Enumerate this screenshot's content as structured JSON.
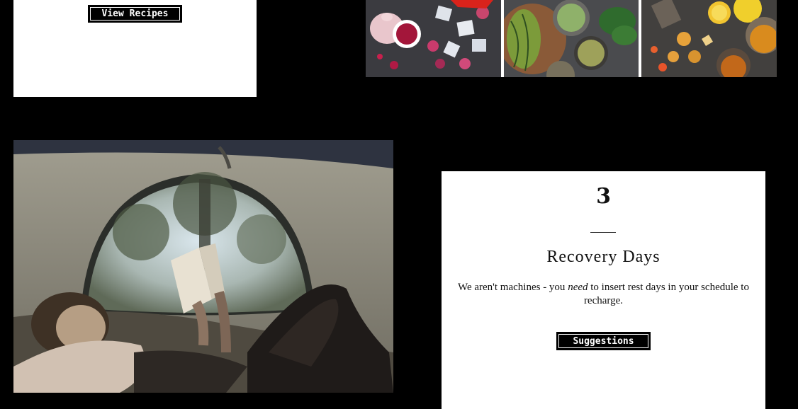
{
  "recipes_card": {
    "button_label": "View Recipes"
  },
  "food_gallery": {
    "panels": [
      {
        "name": "berries-and-ice-photo"
      },
      {
        "name": "melon-and-herbs-photo"
      },
      {
        "name": "citrus-and-spices-photo"
      }
    ]
  },
  "tent_photo": {
    "name": "woman-reading-in-tent-photo"
  },
  "recovery_card": {
    "number": "3",
    "title": "Recovery Days",
    "desc_before": "We aren't machines - you ",
    "desc_emphasis": "need",
    "desc_after": " to insert rest days in your schedule to recharge.",
    "button_label": "Suggestions"
  }
}
